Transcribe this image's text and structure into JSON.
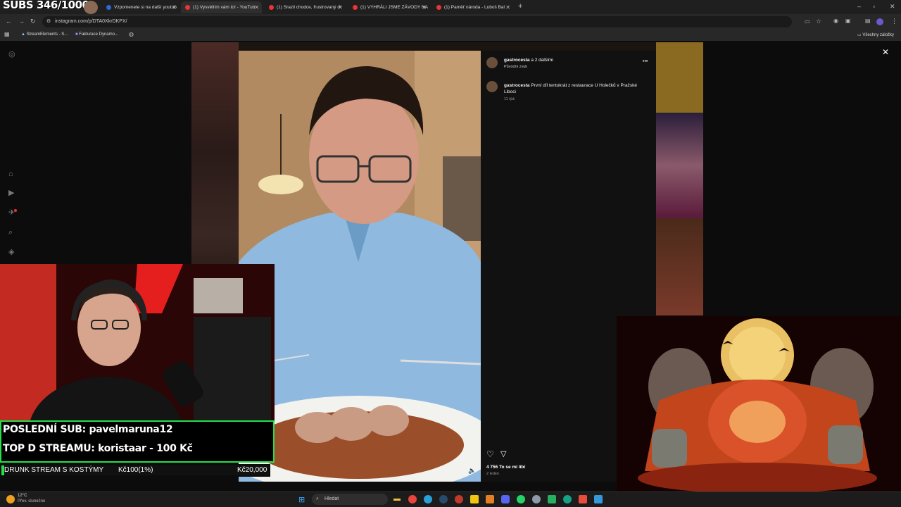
{
  "browser": {
    "tabs": [
      {
        "title": "Vzpomenete si na další youtub"
      },
      {
        "title": "(1) Vysvětlím vám to! - YouTub"
      },
      {
        "title": "(1) Srazil chodce, frustrovaný ď"
      },
      {
        "title": "(1) VYHRÁLI JSME ZÁVODY NA"
      },
      {
        "title": "(1) Paměť národa - Luboš Bal"
      }
    ],
    "new_tab": "+",
    "url": "instagram.com/p/DTA0XkrDKPX/",
    "bookmarks": [
      {
        "label": "StreamElements - S..."
      },
      {
        "label": "Fakturace Dynamo..."
      }
    ],
    "all_bookmarks": "Všechny záložky"
  },
  "instagram": {
    "header_author": "gastrocesta",
    "header_others": "a 2 dalšími",
    "audio_label": "Původní zvuk",
    "caption_author": "gastrocesta",
    "caption_text": "První díl tentokrát z restaurace U Holečků v Pražské Liboci",
    "caption_age": "11 týd.",
    "likes": "4 756 To se mi líbí",
    "post_date": "2 leden",
    "more_icon": "•••",
    "close_icon": "✕"
  },
  "stream": {
    "subs_counter": "SUBS 346/1000",
    "last_sub": "POSLEDNÍ SUB: pavelmaruna12",
    "top_donor": "TOP D STREAMU: koristaar - 100 Kč",
    "goal_name": "DRUNK STREAM S KOSTÝMY",
    "goal_current": "Kč100(1%)",
    "goal_target": "Kč20,000",
    "goal_progress": 0.01
  },
  "taskbar": {
    "weather_temp": "12°C",
    "weather_desc": "Přev. slunečno",
    "search_placeholder": "Hledat"
  },
  "colors": {
    "accent_green": "#23e04a",
    "chrome_bg": "#282828",
    "tab_bg": "#1f1f1f",
    "youtube_red": "#e33"
  }
}
